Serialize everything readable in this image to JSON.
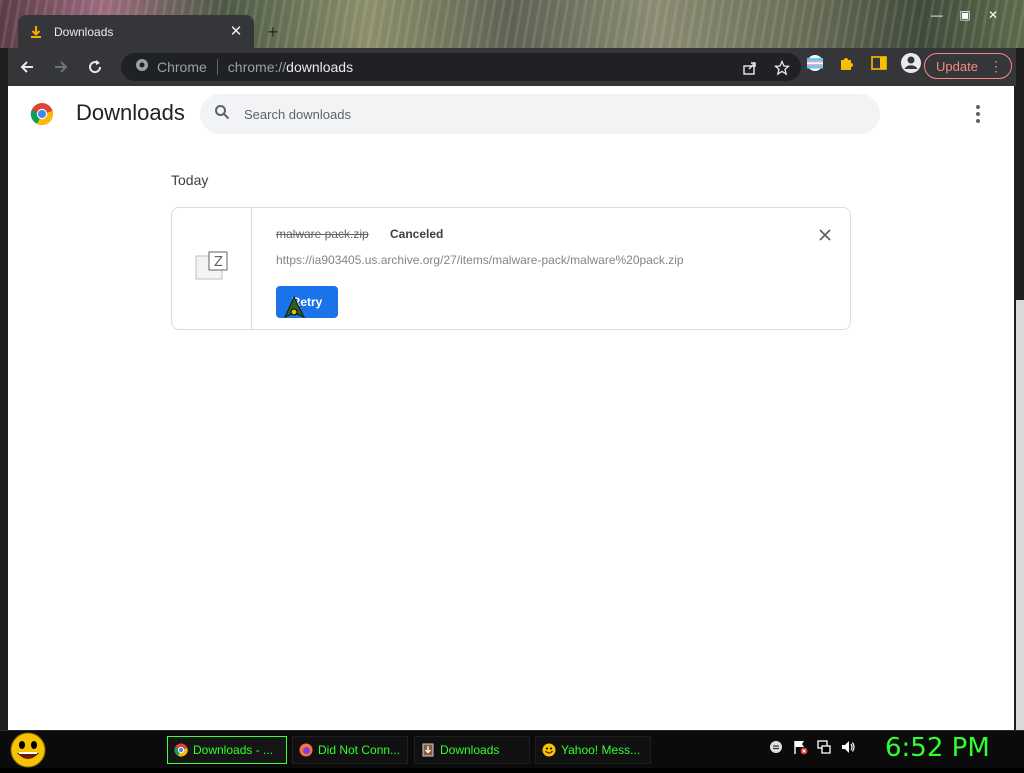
{
  "browser": {
    "tab_title": "Downloads",
    "omnibox_scheme": "Chrome",
    "omnibox_url_prefix": "chrome://",
    "omnibox_url_path": "downloads",
    "update_label": "Update"
  },
  "page": {
    "title": "Downloads",
    "search_placeholder": "Search downloads",
    "section_date": "Today",
    "download": {
      "file_name": "malware pack.zip",
      "status": "Canceled",
      "url": "https://ia903405.us.archive.org/27/items/malware-pack/malware%20pack.zip",
      "retry_label": "Retry"
    }
  },
  "taskbar": {
    "items": [
      {
        "label": "Downloads - ...",
        "icon": "chrome-icon",
        "active": true
      },
      {
        "label": "Did Not Conn...",
        "icon": "firefox-icon",
        "active": false
      },
      {
        "label": "Downloads",
        "icon": "downloads-folder-icon",
        "active": false
      },
      {
        "label": "Yahoo! Mess...",
        "icon": "yahoo-messenger-icon",
        "active": false
      }
    ],
    "clock": "6:52 PM"
  },
  "colors": {
    "accent": "#1a73e8",
    "update": "#f28b82",
    "taskbar_text": "#2fff2f"
  }
}
